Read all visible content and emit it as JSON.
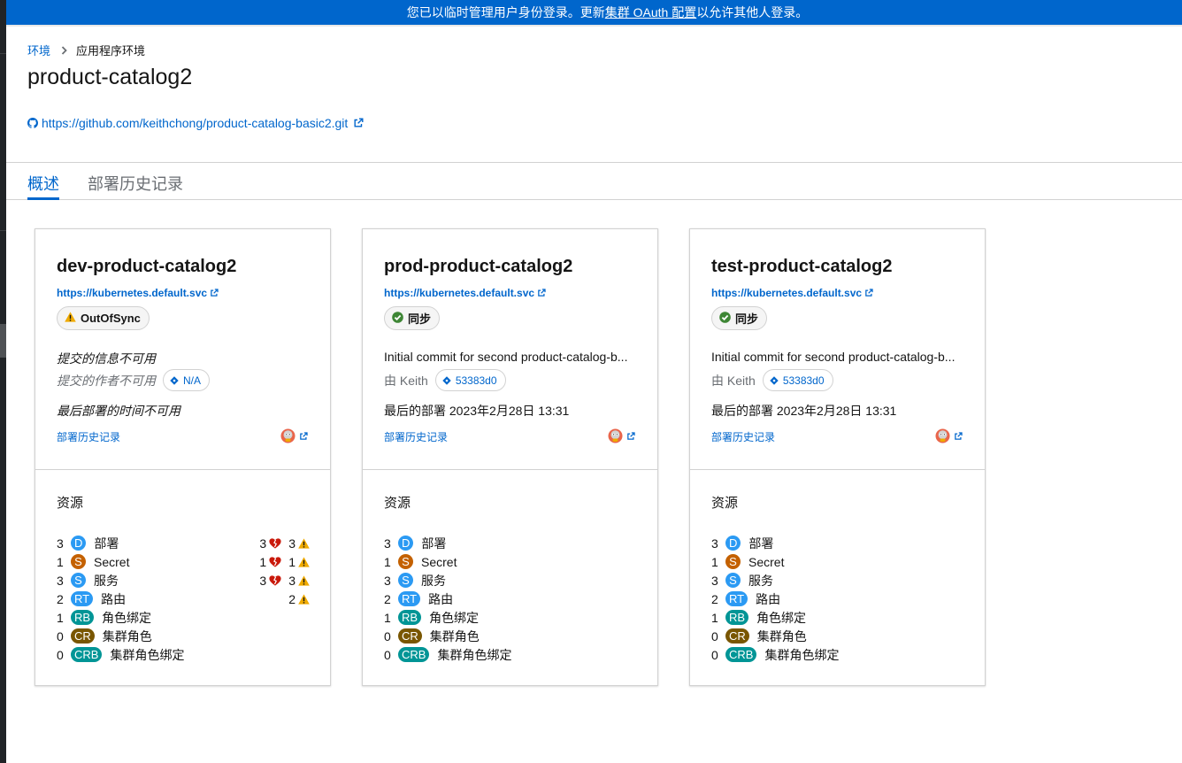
{
  "banner": {
    "prefix": "您已以临时管理用户身份登录。更新",
    "link": "集群 OAuth 配置",
    "suffix": "以允许其他人登录。"
  },
  "breadcrumb": {
    "parent": "环境",
    "current": "应用程序环境"
  },
  "page": {
    "title": "product-catalog2",
    "repo_url": "https://github.com/keithchong/product-catalog-basic2.git"
  },
  "tabs": [
    {
      "label": "概述",
      "active": true
    },
    {
      "label": "部署历史记录",
      "active": false
    }
  ],
  "colors": {
    "link": "#0066cc",
    "deployment": "#2b9af3",
    "secret": "#c46100",
    "service": "#2b9af3",
    "route": "#2b9af3",
    "rolebinding": "#009596",
    "clusterrole": "#795600",
    "clusterrolebinding": "#009596",
    "warning": "#f0ab00",
    "success": "#3e8635",
    "danger": "#c9190b"
  },
  "environments": [
    {
      "name": "dev-product-catalog2",
      "cluster_url": "https://kubernetes.default.svc",
      "status": "OutOfSync",
      "status_icon": "warning-triangle-icon",
      "commit_message": "提交的信息不可用",
      "author": "提交的作者不可用",
      "commit_id": "N/A",
      "last_deployed": "最后部署的时间不可用",
      "unavailable": true,
      "history_link": "部署历史记录",
      "resources_title": "资源",
      "resources": [
        {
          "count": "3",
          "badge": "D",
          "label": "部署",
          "color": "deployment",
          "degraded": "3",
          "warning": "3"
        },
        {
          "count": "1",
          "badge": "S",
          "label": "Secret",
          "color": "secret",
          "degraded": "1",
          "warning": "1"
        },
        {
          "count": "3",
          "badge": "S",
          "label": "服务",
          "color": "service",
          "degraded": "3",
          "warning": "3"
        },
        {
          "count": "2",
          "badge": "RT",
          "label": "路由",
          "color": "route",
          "degraded": "",
          "warning": "2"
        },
        {
          "count": "1",
          "badge": "RB",
          "label": "角色绑定",
          "color": "rolebinding",
          "degraded": "",
          "warning": ""
        },
        {
          "count": "0",
          "badge": "CR",
          "label": "集群角色",
          "color": "clusterrole",
          "degraded": "",
          "warning": ""
        },
        {
          "count": "0",
          "badge": "CRB",
          "label": "集群角色绑定",
          "color": "clusterrolebinding",
          "degraded": "",
          "warning": ""
        }
      ]
    },
    {
      "name": "prod-product-catalog2",
      "cluster_url": "https://kubernetes.default.svc",
      "status": "同步",
      "status_icon": "check-circle-icon",
      "commit_message": "Initial commit for second product-catalog-b...",
      "author": "由 Keith",
      "commit_id": "53383d0",
      "last_deployed": "最后的部署 2023年2月28日 13:31",
      "unavailable": false,
      "history_link": "部署历史记录",
      "resources_title": "资源",
      "resources": [
        {
          "count": "3",
          "badge": "D",
          "label": "部署",
          "color": "deployment",
          "degraded": "",
          "warning": ""
        },
        {
          "count": "1",
          "badge": "S",
          "label": "Secret",
          "color": "secret",
          "degraded": "",
          "warning": ""
        },
        {
          "count": "3",
          "badge": "S",
          "label": "服务",
          "color": "service",
          "degraded": "",
          "warning": ""
        },
        {
          "count": "2",
          "badge": "RT",
          "label": "路由",
          "color": "route",
          "degraded": "",
          "warning": ""
        },
        {
          "count": "1",
          "badge": "RB",
          "label": "角色绑定",
          "color": "rolebinding",
          "degraded": "",
          "warning": ""
        },
        {
          "count": "0",
          "badge": "CR",
          "label": "集群角色",
          "color": "clusterrole",
          "degraded": "",
          "warning": ""
        },
        {
          "count": "0",
          "badge": "CRB",
          "label": "集群角色绑定",
          "color": "clusterrolebinding",
          "degraded": "",
          "warning": ""
        }
      ]
    },
    {
      "name": "test-product-catalog2",
      "cluster_url": "https://kubernetes.default.svc",
      "status": "同步",
      "status_icon": "check-circle-icon",
      "commit_message": "Initial commit for second product-catalog-b...",
      "author": "由 Keith",
      "commit_id": "53383d0",
      "last_deployed": "最后的部署 2023年2月28日 13:31",
      "unavailable": false,
      "history_link": "部署历史记录",
      "resources_title": "资源",
      "resources": [
        {
          "count": "3",
          "badge": "D",
          "label": "部署",
          "color": "deployment",
          "degraded": "",
          "warning": ""
        },
        {
          "count": "1",
          "badge": "S",
          "label": "Secret",
          "color": "secret",
          "degraded": "",
          "warning": ""
        },
        {
          "count": "3",
          "badge": "S",
          "label": "服务",
          "color": "service",
          "degraded": "",
          "warning": ""
        },
        {
          "count": "2",
          "badge": "RT",
          "label": "路由",
          "color": "route",
          "degraded": "",
          "warning": ""
        },
        {
          "count": "1",
          "badge": "RB",
          "label": "角色绑定",
          "color": "rolebinding",
          "degraded": "",
          "warning": ""
        },
        {
          "count": "0",
          "badge": "CR",
          "label": "集群角色",
          "color": "clusterrole",
          "degraded": "",
          "warning": ""
        },
        {
          "count": "0",
          "badge": "CRB",
          "label": "集群角色绑定",
          "color": "clusterrolebinding",
          "degraded": "",
          "warning": ""
        }
      ]
    }
  ]
}
